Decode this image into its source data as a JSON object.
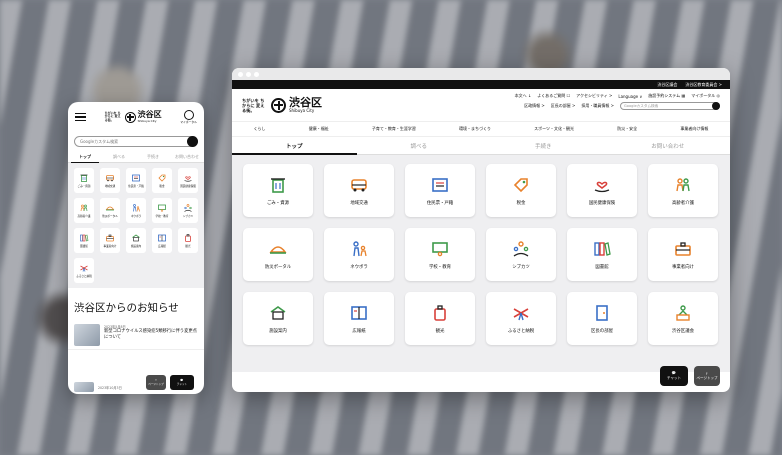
{
  "colors": {
    "accent_green": "#3e9a4a",
    "accent_orange": "#e8822c",
    "accent_blue": "#3a6fc6",
    "accent_red": "#d8403a",
    "dark": "#111111"
  },
  "desktop": {
    "topstrip": [
      "渋谷区議会",
      "渋谷区教育委員会 >"
    ],
    "tagline": "ちがいを ちからに 変える街。",
    "logo_jp": "渋谷区",
    "logo_en": "Shibuya City",
    "util_row1": [
      "本文へ ↓",
      "よくあるご質問 ☐",
      "アクセシビリティ >",
      "Language ∨",
      "施設予約システム ▦",
      "マイポータル ◎"
    ],
    "util_row2": [
      "区政情報 >",
      "区長の部屋 >",
      "採用・職員情報 >"
    ],
    "search_placeholder": "Googleカスタム検索",
    "categories": [
      "くらし",
      "健康・福祉",
      "子育て・教育・生涯学習",
      "環境・まちづくり",
      "スポーツ・文化・観光",
      "防災・安全",
      "事業者向け情報"
    ],
    "tabs": [
      "トップ",
      "調べる",
      "手続き",
      "お問い合わせ"
    ],
    "cards": [
      {
        "label": "ごみ・資源",
        "icon": "trash-icon"
      },
      {
        "label": "地域交通",
        "icon": "bus-icon"
      },
      {
        "label": "住民票・戸籍",
        "icon": "document-icon"
      },
      {
        "label": "税金",
        "icon": "tag-icon"
      },
      {
        "label": "国民健康保険",
        "icon": "hand-heart-icon"
      },
      {
        "label": "高齢者介護",
        "icon": "people-icon"
      },
      {
        "label": "防災ポータル",
        "icon": "helmet-icon"
      },
      {
        "label": "ネウボラ",
        "icon": "family-icon"
      },
      {
        "label": "学校・教育",
        "icon": "board-icon"
      },
      {
        "label": "シブカツ",
        "icon": "group-icon"
      },
      {
        "label": "図書館",
        "icon": "books-icon"
      },
      {
        "label": "事業者向け",
        "icon": "briefcase-icon"
      },
      {
        "label": "施設案内",
        "icon": "building-icon"
      },
      {
        "label": "広報紙",
        "icon": "newspaper-icon"
      },
      {
        "label": "観光",
        "icon": "suitcase-icon"
      },
      {
        "label": "ふるさと納税",
        "icon": "ribbon-icon"
      },
      {
        "label": "区長の部屋",
        "icon": "door-icon"
      },
      {
        "label": "渋谷区議会",
        "icon": "council-icon"
      }
    ],
    "chat_label": "チャット",
    "top_label": "ページトップ"
  },
  "mobile": {
    "tagline": "ちがいを ちからに 変える街。",
    "logo_jp": "渋谷区",
    "logo_en": "Shibuya City",
    "menu_label": "マイポータル",
    "search_placeholder": "Googleカスタム検索",
    "tabs": [
      "トップ",
      "調べる",
      "手続き",
      "お問い合わせ"
    ],
    "cards": [
      {
        "label": "ごみ・資源",
        "icon": "trash-icon"
      },
      {
        "label": "地域交通",
        "icon": "bus-icon"
      },
      {
        "label": "住民票・戸籍",
        "icon": "document-icon"
      },
      {
        "label": "税金",
        "icon": "tag-icon"
      },
      {
        "label": "国民健康保険",
        "icon": "hand-heart-icon"
      },
      {
        "label": "高齢者介護",
        "icon": "people-icon"
      },
      {
        "label": "防災ポータル",
        "icon": "helmet-icon"
      },
      {
        "label": "ネウボラ",
        "icon": "family-icon"
      },
      {
        "label": "学校・教育",
        "icon": "board-icon"
      },
      {
        "label": "シブカツ",
        "icon": "group-icon"
      },
      {
        "label": "図書館",
        "icon": "books-icon"
      },
      {
        "label": "事業者向け",
        "icon": "briefcase-icon"
      },
      {
        "label": "施設案内",
        "icon": "building-icon"
      },
      {
        "label": "広報紙",
        "icon": "newspaper-icon"
      },
      {
        "label": "観光",
        "icon": "suitcase-icon"
      },
      {
        "label": "ふるさと納税",
        "icon": "ribbon-icon"
      }
    ],
    "news_title": "渋谷区からのお知らせ",
    "news": [
      {
        "date": "2023年5月8日",
        "text": "新型コロナウイルス感染症5類移行に伴う変更点について"
      }
    ],
    "news_next_date": "2023年10月3日",
    "top_label": "ページトップ",
    "chat_label": "チャット"
  }
}
